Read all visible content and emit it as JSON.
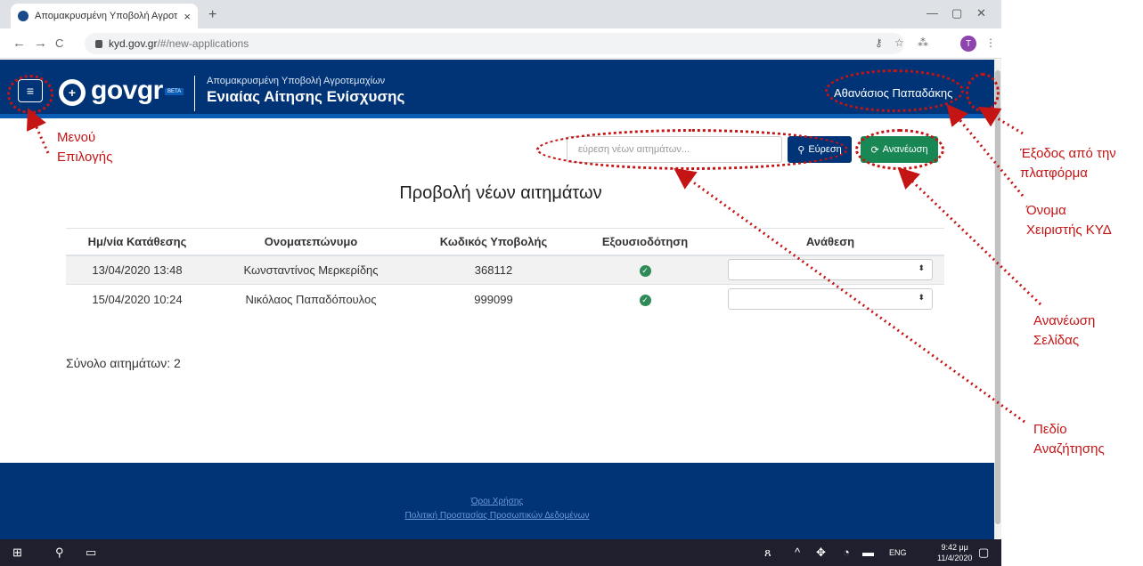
{
  "browser": {
    "tab_title": "Απομακρυσμένη Υποβολή Αγροτ",
    "tab_close": "×",
    "new_tab": "+",
    "url_domain": "kyd.gov.gr",
    "url_path": "/#/new-applications",
    "profile_initial": "T"
  },
  "header": {
    "logo_text": "govgr",
    "beta": "BETA",
    "subtitle": "Απομακρυσμένη Υποβολή Αγροτεμαχίων",
    "title": "Ενιαίας Αίτησης Ενίσχυσης",
    "user_name": "Αθανάσιος Παπαδάκης"
  },
  "toolbar": {
    "search_placeholder": "εύρεση νέων αιτημάτων...",
    "find_label": "Εύρεση",
    "refresh_label": "Ανανέωση"
  },
  "main": {
    "heading": "Προβολή νέων αιτημάτων",
    "columns": [
      "Ημ/νία Κατάθεσης",
      "Ονοματεπώνυμο",
      "Κωδικός Υποβολής",
      "Εξουσιοδότηση",
      "Ανάθεση"
    ],
    "rows": [
      {
        "date": "13/04/2020 13:48",
        "name": "Κωνσταντίνος Μερκερίδης",
        "code": "368112"
      },
      {
        "date": "15/04/2020 10:24",
        "name": "Νικόλαος Παπαδόπουλος",
        "code": "999099"
      }
    ],
    "total": "Σύνολο αιτημάτων: 2"
  },
  "footer": {
    "terms": "Όροι Χρήσης",
    "privacy": "Πολιτική Προστασίας Προσωπικών Δεδομένων"
  },
  "taskbar": {
    "lang": "ENG",
    "time": "9:42 μμ",
    "date": "11/4/2020"
  },
  "annotations": {
    "menu": [
      "Μενού",
      "Επιλογής"
    ],
    "logout": [
      "Έξοδος από την",
      "πλατφόρμα"
    ],
    "operator": [
      "Όνομα",
      "Χειριστής ΚΥΔ"
    ],
    "refresh": [
      "Ανανέωση",
      "Σελίδας"
    ],
    "search": [
      "Πεδίο",
      "Αναζήτησης"
    ]
  },
  "colors": {
    "brand": "#003476",
    "annotation": "#c41414",
    "refresh_button": "#198754"
  }
}
